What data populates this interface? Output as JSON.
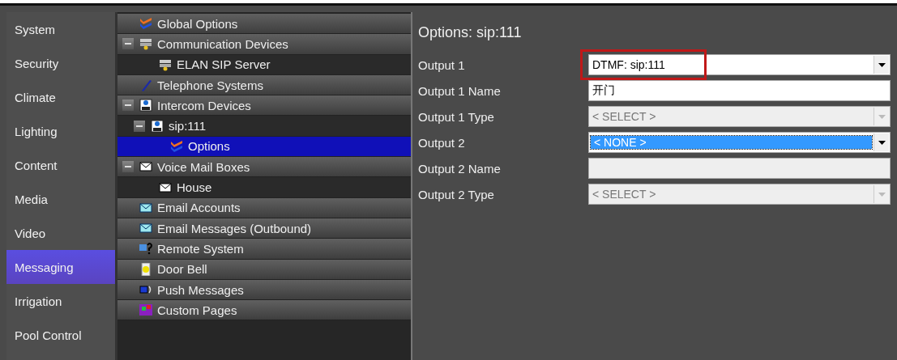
{
  "sidebar": {
    "items": [
      {
        "label": "System",
        "selected": false
      },
      {
        "label": "Security",
        "selected": false
      },
      {
        "label": "Climate",
        "selected": false
      },
      {
        "label": "Lighting",
        "selected": false
      },
      {
        "label": "Content",
        "selected": false
      },
      {
        "label": "Media",
        "selected": false
      },
      {
        "label": "Video",
        "selected": false
      },
      {
        "label": "Messaging",
        "selected": true
      },
      {
        "label": "Irrigation",
        "selected": false
      },
      {
        "label": "Pool Control",
        "selected": false
      }
    ]
  },
  "tree": {
    "items": [
      {
        "label": "Global Options",
        "selected": false
      },
      {
        "label": "Communication Devices",
        "selected": false,
        "expanded": true,
        "children": [
          {
            "label": "ELAN SIP Server",
            "selected": false
          }
        ]
      },
      {
        "label": "Telephone Systems",
        "selected": false
      },
      {
        "label": "Intercom Devices",
        "selected": false,
        "expanded": true,
        "children": [
          {
            "label": "sip:111",
            "selected": false,
            "expanded": true,
            "children": [
              {
                "label": "Options",
                "selected": true
              }
            ]
          }
        ]
      },
      {
        "label": "Voice Mail Boxes",
        "selected": false,
        "expanded": true,
        "children": [
          {
            "label": "House",
            "selected": false
          }
        ]
      },
      {
        "label": "Email Accounts",
        "selected": false
      },
      {
        "label": "Email Messages (Outbound)",
        "selected": false
      },
      {
        "label": "Remote System",
        "selected": false
      },
      {
        "label": "Door Bell",
        "selected": false
      },
      {
        "label": "Push Messages",
        "selected": false
      },
      {
        "label": "Custom Pages",
        "selected": false
      }
    ]
  },
  "options": {
    "title": "Options: sip:111",
    "fields": [
      {
        "label": "Output 1",
        "kind": "select",
        "value": "DTMF: sip:111",
        "disabled": false,
        "focused": false,
        "highlighted": true
      },
      {
        "label": "Output 1 Name",
        "kind": "text",
        "value": "开门",
        "disabled": false,
        "focused": false,
        "highlighted": false
      },
      {
        "label": "Output 1 Type",
        "kind": "select",
        "value": "< SELECT >",
        "disabled": true,
        "focused": false,
        "highlighted": false
      },
      {
        "label": "Output 2",
        "kind": "select",
        "value": "< NONE >",
        "disabled": false,
        "focused": true,
        "highlighted": false
      },
      {
        "label": "Output 2 Name",
        "kind": "text",
        "disabled": true,
        "focused": false,
        "highlighted": false
      },
      {
        "label": "Output 2 Type",
        "kind": "select",
        "value": "< SELECT >",
        "disabled": true,
        "focused": false,
        "highlighted": false
      }
    ]
  }
}
